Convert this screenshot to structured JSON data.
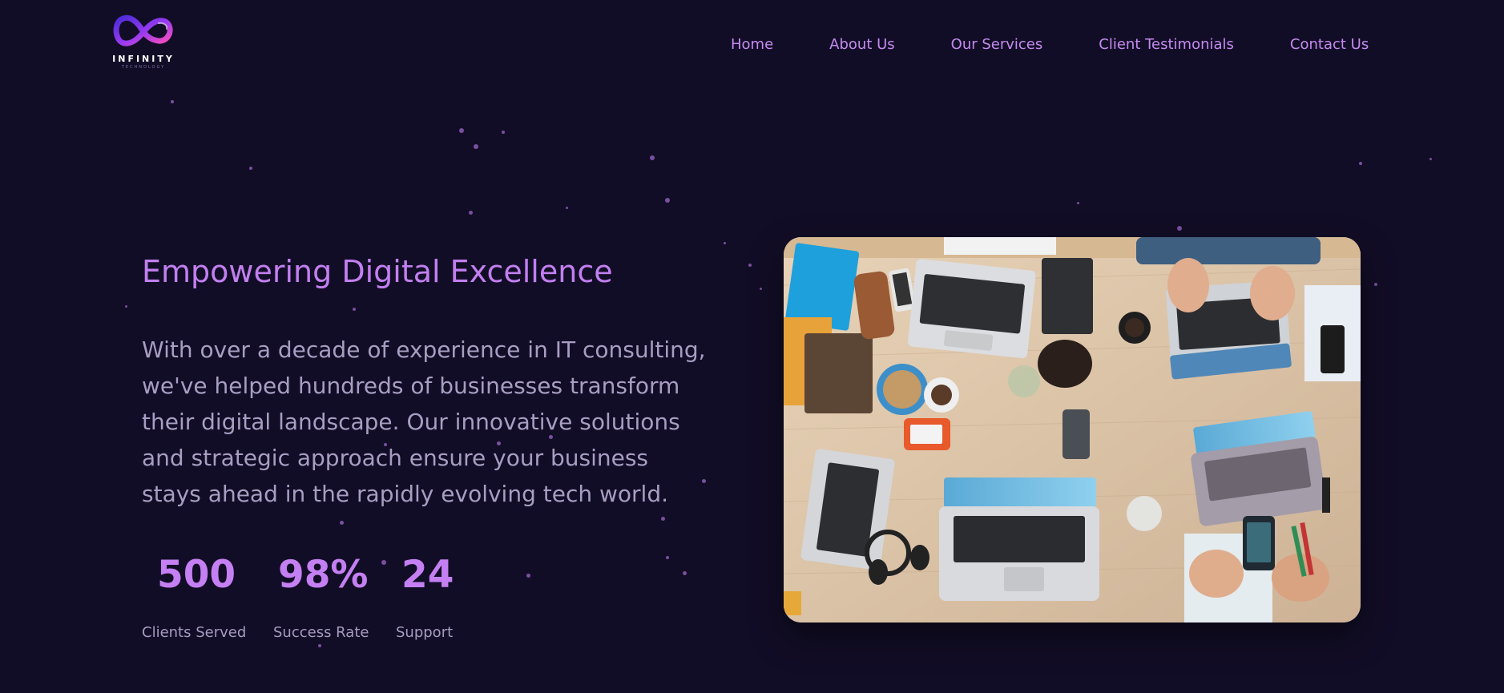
{
  "brand": {
    "name": "INFINITY",
    "tagline": "TECHNOLOGY",
    "logo_icon": "infinity-icon"
  },
  "nav": {
    "items": [
      {
        "label": "Home"
      },
      {
        "label": "About Us"
      },
      {
        "label": "Our Services"
      },
      {
        "label": "Client Testimonials"
      },
      {
        "label": "Contact Us"
      }
    ]
  },
  "hero": {
    "title": "Empowering Digital Excellence",
    "description": "With over a decade of experience in IT consulting, we've helped hundreds of businesses transform their digital landscape. Our innovative solutions and strategic approach ensure your business stays ahead in the rapidly evolving tech world.",
    "image_subject": "overhead view of a team working with laptops on a wooden table"
  },
  "stats": [
    {
      "value": "500",
      "label": "Clients Served"
    },
    {
      "value": "98%",
      "label": "Success Rate"
    },
    {
      "value": "24",
      "label": "Support"
    }
  ],
  "colors": {
    "background": "#120d26",
    "accent": "#c27ff0",
    "nav_link": "#c48bf0",
    "body_text": "#a79ec2",
    "particle": "#7a4fa0"
  }
}
